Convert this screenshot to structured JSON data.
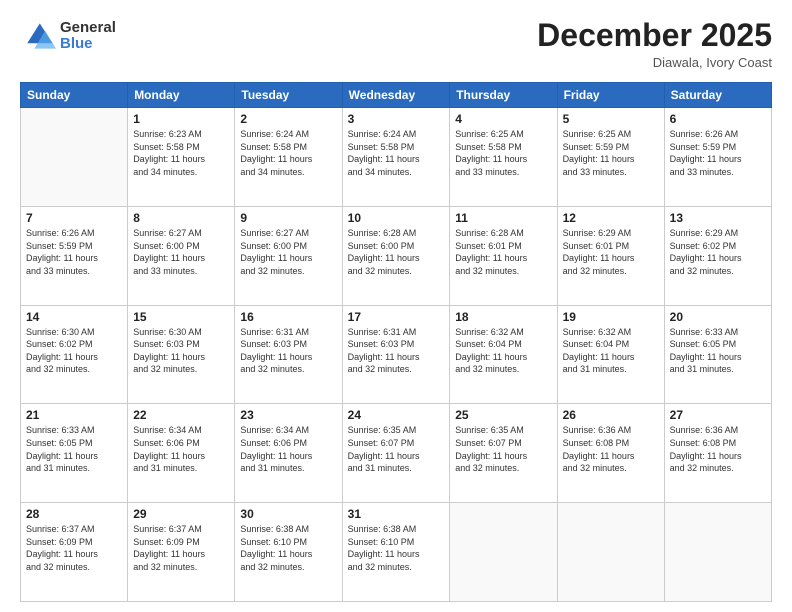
{
  "logo": {
    "general": "General",
    "blue": "Blue"
  },
  "header": {
    "month": "December 2025",
    "location": "Diawala, Ivory Coast"
  },
  "days_of_week": [
    "Sunday",
    "Monday",
    "Tuesday",
    "Wednesday",
    "Thursday",
    "Friday",
    "Saturday"
  ],
  "weeks": [
    [
      {
        "day": "",
        "info": ""
      },
      {
        "day": "1",
        "info": "Sunrise: 6:23 AM\nSunset: 5:58 PM\nDaylight: 11 hours\nand 34 minutes."
      },
      {
        "day": "2",
        "info": "Sunrise: 6:24 AM\nSunset: 5:58 PM\nDaylight: 11 hours\nand 34 minutes."
      },
      {
        "day": "3",
        "info": "Sunrise: 6:24 AM\nSunset: 5:58 PM\nDaylight: 11 hours\nand 34 minutes."
      },
      {
        "day": "4",
        "info": "Sunrise: 6:25 AM\nSunset: 5:58 PM\nDaylight: 11 hours\nand 33 minutes."
      },
      {
        "day": "5",
        "info": "Sunrise: 6:25 AM\nSunset: 5:59 PM\nDaylight: 11 hours\nand 33 minutes."
      },
      {
        "day": "6",
        "info": "Sunrise: 6:26 AM\nSunset: 5:59 PM\nDaylight: 11 hours\nand 33 minutes."
      }
    ],
    [
      {
        "day": "7",
        "info": "Sunrise: 6:26 AM\nSunset: 5:59 PM\nDaylight: 11 hours\nand 33 minutes."
      },
      {
        "day": "8",
        "info": "Sunrise: 6:27 AM\nSunset: 6:00 PM\nDaylight: 11 hours\nand 33 minutes."
      },
      {
        "day": "9",
        "info": "Sunrise: 6:27 AM\nSunset: 6:00 PM\nDaylight: 11 hours\nand 32 minutes."
      },
      {
        "day": "10",
        "info": "Sunrise: 6:28 AM\nSunset: 6:00 PM\nDaylight: 11 hours\nand 32 minutes."
      },
      {
        "day": "11",
        "info": "Sunrise: 6:28 AM\nSunset: 6:01 PM\nDaylight: 11 hours\nand 32 minutes."
      },
      {
        "day": "12",
        "info": "Sunrise: 6:29 AM\nSunset: 6:01 PM\nDaylight: 11 hours\nand 32 minutes."
      },
      {
        "day": "13",
        "info": "Sunrise: 6:29 AM\nSunset: 6:02 PM\nDaylight: 11 hours\nand 32 minutes."
      }
    ],
    [
      {
        "day": "14",
        "info": "Sunrise: 6:30 AM\nSunset: 6:02 PM\nDaylight: 11 hours\nand 32 minutes."
      },
      {
        "day": "15",
        "info": "Sunrise: 6:30 AM\nSunset: 6:03 PM\nDaylight: 11 hours\nand 32 minutes."
      },
      {
        "day": "16",
        "info": "Sunrise: 6:31 AM\nSunset: 6:03 PM\nDaylight: 11 hours\nand 32 minutes."
      },
      {
        "day": "17",
        "info": "Sunrise: 6:31 AM\nSunset: 6:03 PM\nDaylight: 11 hours\nand 32 minutes."
      },
      {
        "day": "18",
        "info": "Sunrise: 6:32 AM\nSunset: 6:04 PM\nDaylight: 11 hours\nand 32 minutes."
      },
      {
        "day": "19",
        "info": "Sunrise: 6:32 AM\nSunset: 6:04 PM\nDaylight: 11 hours\nand 31 minutes."
      },
      {
        "day": "20",
        "info": "Sunrise: 6:33 AM\nSunset: 6:05 PM\nDaylight: 11 hours\nand 31 minutes."
      }
    ],
    [
      {
        "day": "21",
        "info": "Sunrise: 6:33 AM\nSunset: 6:05 PM\nDaylight: 11 hours\nand 31 minutes."
      },
      {
        "day": "22",
        "info": "Sunrise: 6:34 AM\nSunset: 6:06 PM\nDaylight: 11 hours\nand 31 minutes."
      },
      {
        "day": "23",
        "info": "Sunrise: 6:34 AM\nSunset: 6:06 PM\nDaylight: 11 hours\nand 31 minutes."
      },
      {
        "day": "24",
        "info": "Sunrise: 6:35 AM\nSunset: 6:07 PM\nDaylight: 11 hours\nand 31 minutes."
      },
      {
        "day": "25",
        "info": "Sunrise: 6:35 AM\nSunset: 6:07 PM\nDaylight: 11 hours\nand 32 minutes."
      },
      {
        "day": "26",
        "info": "Sunrise: 6:36 AM\nSunset: 6:08 PM\nDaylight: 11 hours\nand 32 minutes."
      },
      {
        "day": "27",
        "info": "Sunrise: 6:36 AM\nSunset: 6:08 PM\nDaylight: 11 hours\nand 32 minutes."
      }
    ],
    [
      {
        "day": "28",
        "info": "Sunrise: 6:37 AM\nSunset: 6:09 PM\nDaylight: 11 hours\nand 32 minutes."
      },
      {
        "day": "29",
        "info": "Sunrise: 6:37 AM\nSunset: 6:09 PM\nDaylight: 11 hours\nand 32 minutes."
      },
      {
        "day": "30",
        "info": "Sunrise: 6:38 AM\nSunset: 6:10 PM\nDaylight: 11 hours\nand 32 minutes."
      },
      {
        "day": "31",
        "info": "Sunrise: 6:38 AM\nSunset: 6:10 PM\nDaylight: 11 hours\nand 32 minutes."
      },
      {
        "day": "",
        "info": ""
      },
      {
        "day": "",
        "info": ""
      },
      {
        "day": "",
        "info": ""
      }
    ]
  ]
}
